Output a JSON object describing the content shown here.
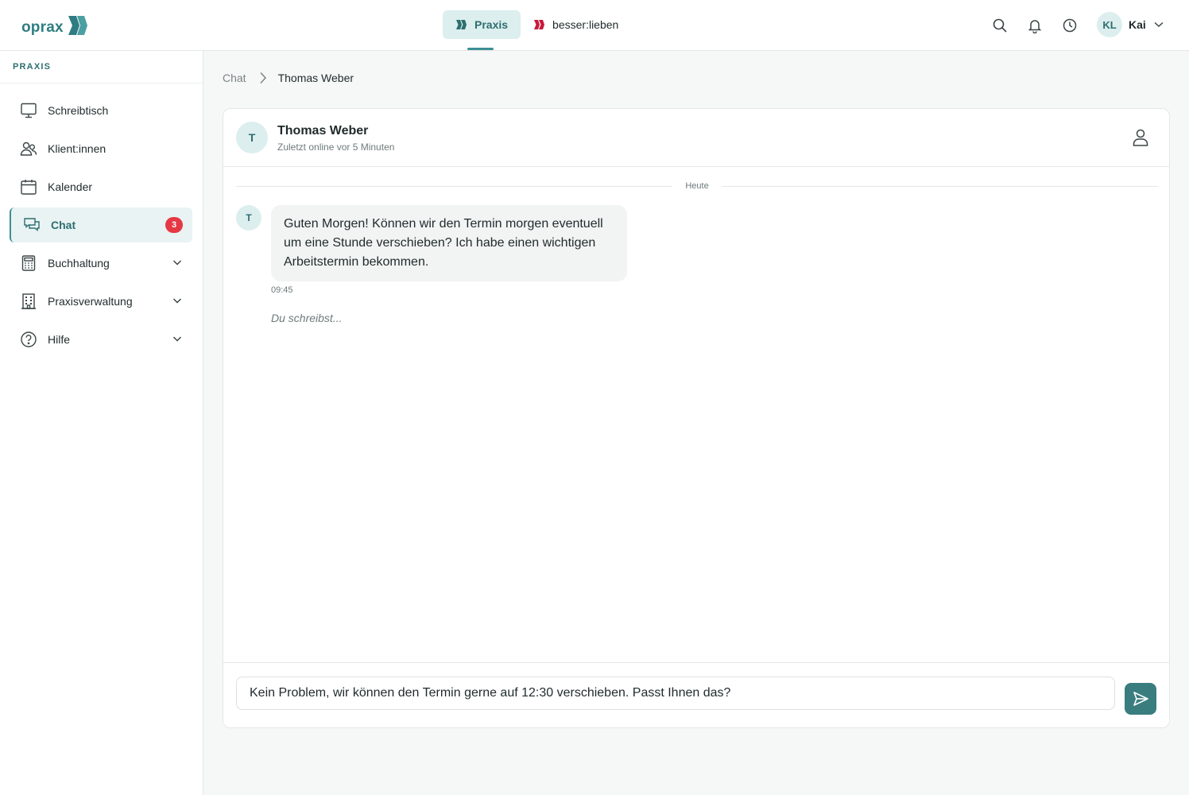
{
  "brand": {
    "logo_text": "oprax",
    "accent": "#3d8f92",
    "secondary_brand": "#c8193c"
  },
  "topnav": {
    "tabs": [
      {
        "label": "Praxis",
        "active": true
      },
      {
        "label": "besser:lieben",
        "active": false
      }
    ],
    "icons": [
      "search-icon",
      "bell-icon",
      "clock-icon"
    ],
    "user": {
      "initials": "KL",
      "name": "Kai"
    }
  },
  "sidebar": {
    "heading": "PRAXIS",
    "items": [
      {
        "label": "Schreibtisch",
        "icon": "monitor-icon"
      },
      {
        "label": "Klient:innen",
        "icon": "users-icon"
      },
      {
        "label": "Kalender",
        "icon": "calendar-icon"
      },
      {
        "label": "Chat",
        "icon": "chat-icon",
        "active": true,
        "badge": "3"
      },
      {
        "label": "Buchhaltung",
        "icon": "calculator-icon",
        "expandable": true
      },
      {
        "label": "Praxisverwaltung",
        "icon": "building-icon",
        "expandable": true
      },
      {
        "label": "Hilfe",
        "icon": "help-icon",
        "expandable": true
      }
    ]
  },
  "breadcrumb": {
    "root": "Chat",
    "current": "Thomas Weber"
  },
  "chat": {
    "contact_initial": "T",
    "contact_name": "Thomas Weber",
    "contact_status": "Zuletzt online vor 5 Minuten",
    "date_divider": "Heute",
    "messages": [
      {
        "sender_initial": "T",
        "text": "Guten Morgen! Können wir den Termin morgen eventuell um eine Stunde verschieben? Ich habe einen wichtigen Arbeitstermin bekommen.",
        "time": "09:45"
      }
    ],
    "typing_indicator": "Du schreibst...",
    "composer_value": "Kein Problem, wir können den Termin gerne auf 12:30 verschieben. Passt Ihnen das?"
  }
}
